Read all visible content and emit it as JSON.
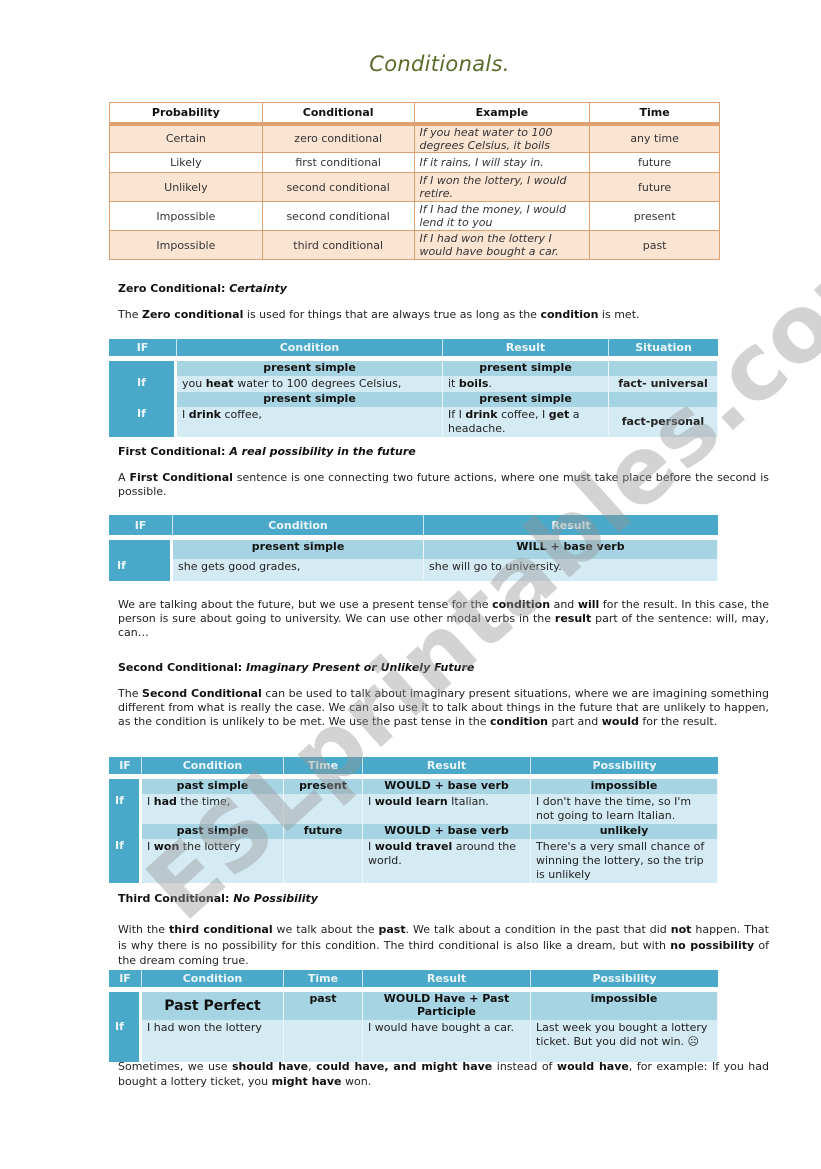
{
  "title": "Conditionals.",
  "overview": {
    "headers": [
      "Probability",
      "Conditional",
      "Example",
      "Time"
    ],
    "rows": [
      {
        "probability": "Certain",
        "conditional": "zero conditional",
        "example": "If you heat water to 100 degrees Celsius, it boils",
        "time": "any time"
      },
      {
        "probability": "Likely",
        "conditional": "first conditional",
        "example": "If it rains, I will stay in.",
        "time": "future"
      },
      {
        "probability": "Unlikely",
        "conditional": "second conditional",
        "example": "If I won the lottery, I would retire.",
        "time": "future"
      },
      {
        "probability": "Impossible",
        "conditional": "second conditional",
        "example": "If I had the money, I would lend it to you",
        "time": "present"
      },
      {
        "probability": "Impossible",
        "conditional": "third conditional",
        "example": "If I had won the lottery I would have bought a car.",
        "time": "past"
      }
    ]
  },
  "zero": {
    "heading": "Zero Conditional:",
    "heading_em": "Certainty",
    "intro": [
      "The ",
      "Zero conditional",
      " is used for things that are always true as long as the ",
      "condition",
      " is met."
    ],
    "headers": [
      "IF",
      "Condition",
      "Result",
      "Situation"
    ],
    "rows": [
      {
        "tense_condition": "present simple",
        "tense_result": "present simple",
        "if": "If",
        "condition": [
          "you ",
          "heat",
          " water to 100 degrees Celsius,"
        ],
        "result": [
          "it ",
          "boils",
          "."
        ],
        "situation": "fact- universal"
      },
      {
        "tense_condition": "present simple",
        "tense_result": "present simple",
        "if": "If",
        "condition": [
          "I ",
          "drink",
          " coffee,"
        ],
        "result": [
          "If I ",
          "drink",
          " coffee, I ",
          "get",
          " a headache."
        ],
        "situation": "fact-personal"
      }
    ]
  },
  "first": {
    "heading": "First Conditional:",
    "heading_em": "A real possibility in the future",
    "intro": [
      "A ",
      "First Conditional",
      " sentence is one connecting two future actions, where one must take place before the second is possible."
    ],
    "headers": [
      "IF",
      "Condition",
      "Result"
    ],
    "tense_condition": "present simple",
    "tense_result": "WILL + base verb",
    "if": "If",
    "condition": "she gets good grades,",
    "result": "she will go to university.",
    "after": [
      "We are talking about the future, but we use a present tense for the ",
      "condition",
      " and ",
      "will",
      " for the result. In this case, the person is sure about going to university. We can use other modal verbs in the ",
      "result",
      " part of the sentence: will, may, can…"
    ]
  },
  "second": {
    "heading": "Second Conditional:",
    "heading_em": "Imaginary Present or Unlikely Future",
    "intro": [
      "The ",
      "Second Conditional",
      " can be used to talk about imaginary present situations, where we are imagining something different from what is really the case. We can also use it to talk about things in the future that are unlikely to happen, as the condition is unlikely to be met. We use the past tense in the ",
      "condition",
      " part and ",
      "would",
      " for the result."
    ],
    "headers": [
      "IF",
      "Condition",
      "Time",
      "Result",
      "Possibility"
    ],
    "rows": [
      {
        "tense_condition": "past simple",
        "time": "present",
        "tense_result": "WOULD + base verb",
        "possibility_label": "impossible",
        "if": "If",
        "condition": [
          "I ",
          "had",
          " the time,"
        ],
        "result": [
          "I ",
          "would learn",
          " Italian."
        ],
        "possibility": "I don't have the time, so I'm not going to learn Italian."
      },
      {
        "tense_condition": "past simple",
        "time": "future",
        "tense_result": "WOULD + base verb",
        "possibility_label": "unlikely",
        "if": "If",
        "condition": [
          "I ",
          "won",
          " the lottery"
        ],
        "result": [
          "I ",
          "would travel",
          " around the world."
        ],
        "possibility": "There's a very small chance of winning the lottery, so the trip is unlikely"
      }
    ]
  },
  "third": {
    "heading": "Third Conditional:",
    "heading_em": "No Possibility",
    "intro": [
      "With the ",
      "third conditional",
      " we talk about the ",
      "past",
      ". We talk about a condition in the past that did ",
      "not",
      " happen. That is why there is no possibility for this condition. The third conditional is also like a dream, but with ",
      "no possibility",
      " of the dream coming true."
    ],
    "headers": [
      "IF",
      "Condition",
      "Time",
      "Result",
      "Possibility"
    ],
    "tense_condition": "Past Perfect",
    "time": "past",
    "tense_result": "WOULD Have + Past Participle",
    "possibility_label": "impossible",
    "if": "If",
    "condition": "I had won the lottery",
    "result": "I would have bought a car.",
    "possibility": "Last week you bought a lottery ticket. But you did not win. ☹",
    "after": [
      "Sometimes, we use ",
      "should have",
      ", ",
      "could have, and might have",
      " instead of ",
      "would have",
      ", for example: If you had bought a lottery ticket, you ",
      "might have",
      " won."
    ]
  },
  "watermark": "ESLprintables.com"
}
